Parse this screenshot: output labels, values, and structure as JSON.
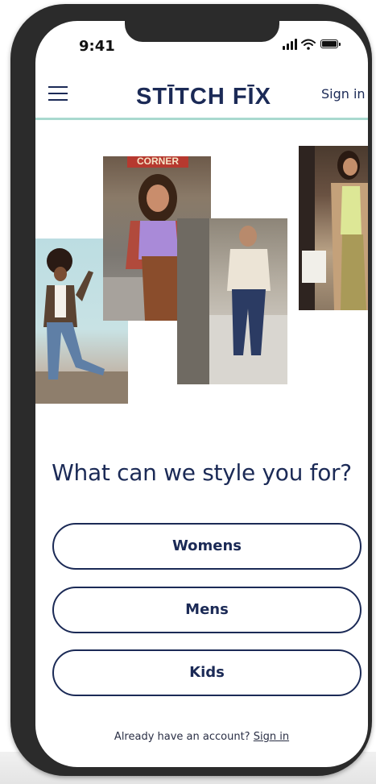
{
  "status_bar": {
    "time": "9:41"
  },
  "header": {
    "logo_text": "STĪTCH FĪX",
    "sign_in_label": "Sign in"
  },
  "hero": {
    "store_sign_text": "CORNER"
  },
  "main": {
    "headline": "What can we style you for?",
    "options": [
      {
        "label": "Womens"
      },
      {
        "label": "Mens"
      },
      {
        "label": "Kids"
      }
    ]
  },
  "footer": {
    "prompt": "Already have an account?",
    "sign_in_link": "Sign in"
  },
  "colors": {
    "brand_navy": "#1b2a56",
    "header_rule": "#a9d9cf",
    "phone_frame": "#2b2b2b"
  },
  "icons": [
    "menu-icon",
    "signal-icon",
    "wifi-icon",
    "battery-icon"
  ]
}
